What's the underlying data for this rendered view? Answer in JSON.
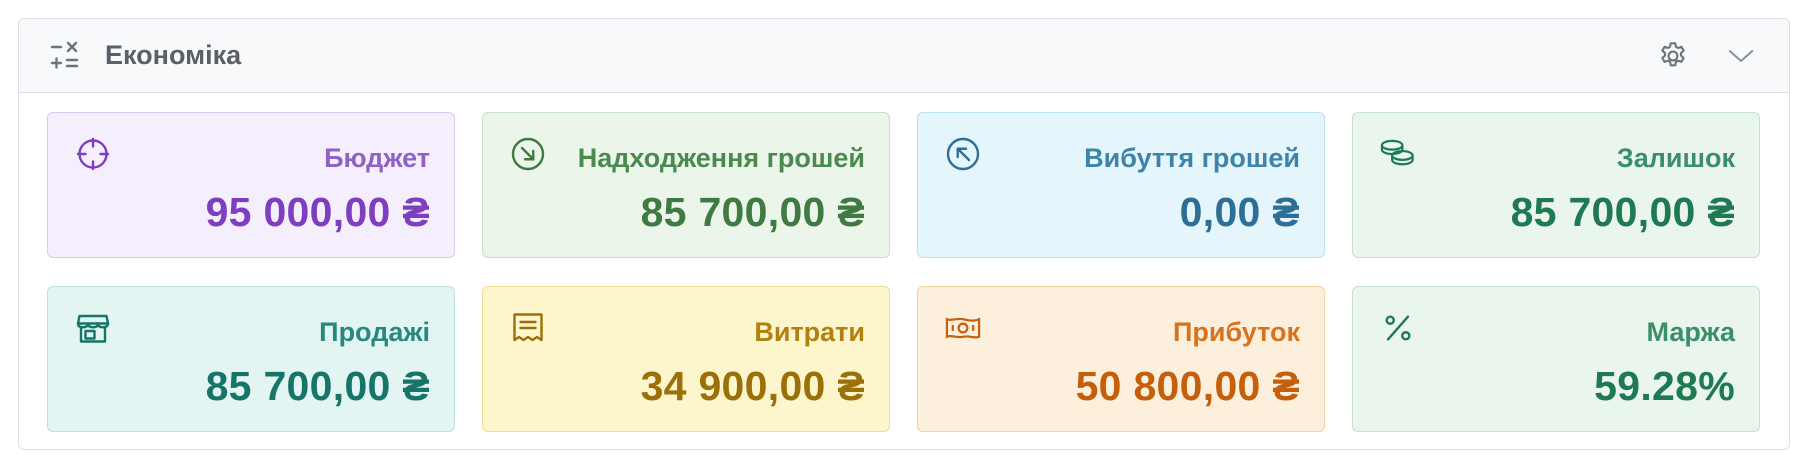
{
  "header": {
    "title": "Економіка",
    "icon": "calculator-operations-icon",
    "actions": [
      {
        "icon": "gear-icon"
      },
      {
        "icon": "chevron-down-icon"
      }
    ]
  },
  "cards": [
    {
      "label": "Бюджет",
      "value": "95 000,00 ₴",
      "icon": "crosshair-icon",
      "bg": "#f5eefc",
      "border": "#dcc9f1",
      "labelColor": "#8f63c6",
      "valueColor": "#7d3fc0"
    },
    {
      "label": "Надходження грошей",
      "value": "85 700,00 ₴",
      "icon": "arrow-down-right-circle-icon",
      "bg": "#ebf5ea",
      "border": "#c6e0c5",
      "labelColor": "#4a8a4e",
      "valueColor": "#3e7a42"
    },
    {
      "label": "Вибуття грошей",
      "value": "0,00 ₴",
      "icon": "arrow-up-left-circle-icon",
      "bg": "#e4f5fc",
      "border": "#bcdfee",
      "labelColor": "#3d84a8",
      "valueColor": "#2e6f96"
    },
    {
      "label": "Залишок",
      "value": "85 700,00 ₴",
      "icon": "coins-icon",
      "bg": "#eaf5ee",
      "border": "#c4e1cd",
      "labelColor": "#3a8f66",
      "valueColor": "#1f7a52"
    },
    {
      "label": "Продажі",
      "value": "85 700,00 ₴",
      "icon": "shop-icon",
      "bg": "#e3f5f3",
      "border": "#b9e2de",
      "labelColor": "#26897d",
      "valueColor": "#167568"
    },
    {
      "label": "Витрати",
      "value": "34 900,00 ₴",
      "icon": "receipt-icon",
      "bg": "#fdf6cc",
      "border": "#f0dd8e",
      "labelColor": "#b0810e",
      "valueColor": "#9c7008"
    },
    {
      "label": "Прибуток",
      "value": "50 800,00 ₴",
      "icon": "cash-icon",
      "bg": "#fcefdb",
      "border": "#f2d1a0",
      "labelColor": "#d7731f",
      "valueColor": "#c45f0c"
    },
    {
      "label": "Маржа",
      "value": "59.28%",
      "icon": "percent-icon",
      "bg": "#eaf5ee",
      "border": "#c4e1cd",
      "labelColor": "#3a8f66",
      "valueColor": "#1f7a52"
    }
  ]
}
